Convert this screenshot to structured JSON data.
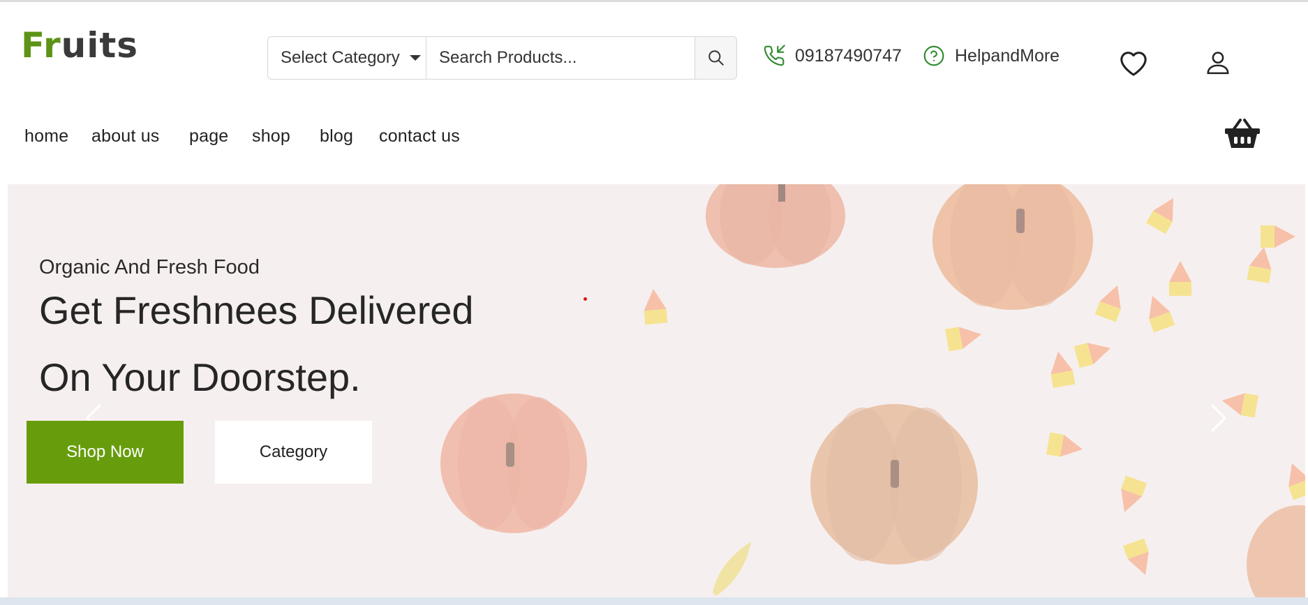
{
  "brand": {
    "logo_part1": "Fr",
    "logo_part2": "uits"
  },
  "search": {
    "category_label": "Select Category",
    "placeholder": "Search Products..."
  },
  "contact": {
    "phone": "09187490747",
    "help_label": "HelpandMore"
  },
  "nav": [
    "home",
    "about us",
    "page",
    "shop",
    "blog",
    "contact us"
  ],
  "hero": {
    "subtitle": "Organic And Fresh Food",
    "title_line1": "Get Freshnees Delivered",
    "title_line2": "On Your Doorstep.",
    "primary_button": "Shop Now",
    "secondary_button": "Category"
  },
  "icons": {
    "phone": "phone-incoming-icon",
    "help": "help-circle-icon",
    "wishlist": "heart-icon",
    "account": "user-icon",
    "cart": "basket-icon"
  },
  "colors": {
    "brand_green": "#5d9417",
    "button_green": "#679d0c",
    "icon_green": "#2f8a2f"
  }
}
